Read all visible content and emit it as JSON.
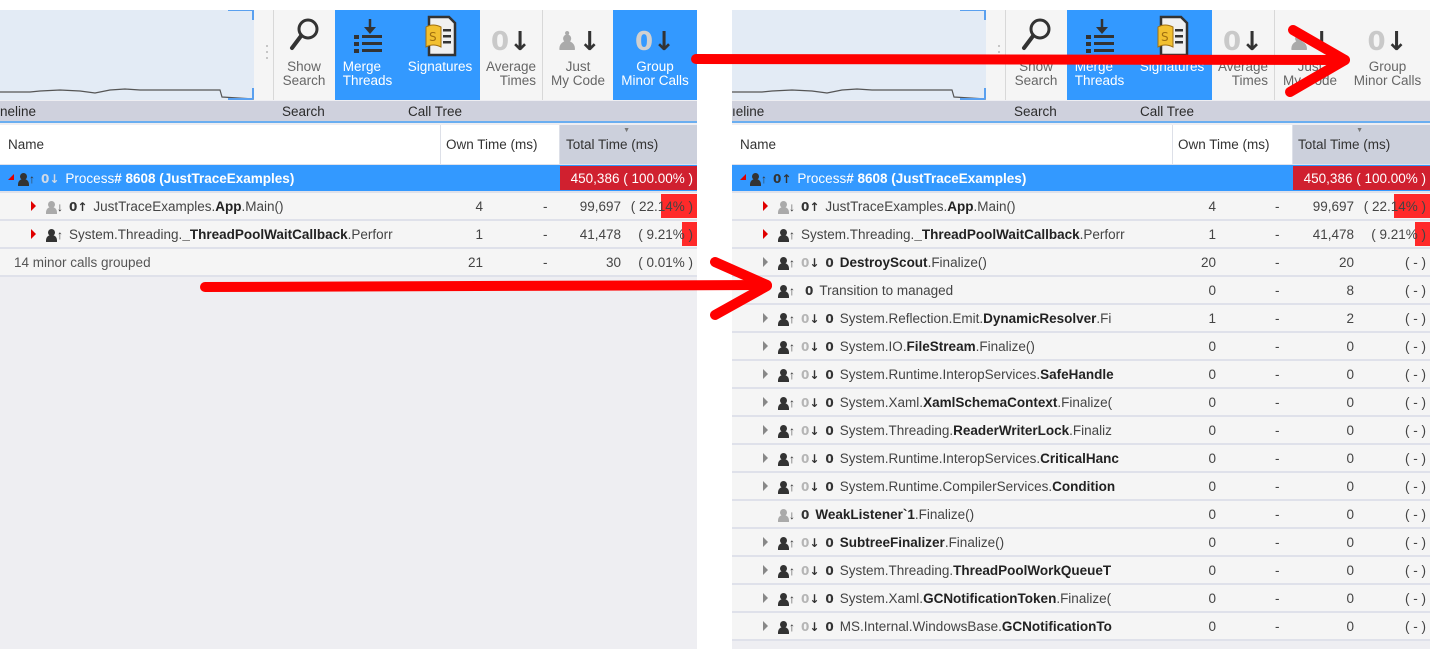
{
  "toolbar": {
    "buttons": [
      {
        "id": "show-search",
        "line1": "Show",
        "line2": "Search",
        "icon": "magnifier-icon"
      },
      {
        "id": "merge-threads",
        "line1": "Merge",
        "line2": "Threads",
        "icon": "merge-threads-icon"
      },
      {
        "id": "signatures",
        "line1": "Signatures",
        "line2": "",
        "icon": "signatures-icon"
      },
      {
        "id": "average-times",
        "line1": "Average",
        "line2": "Times",
        "icon": "zero-down-icon"
      },
      {
        "id": "just-my-code",
        "line1": "Just",
        "line2": "My Code",
        "icon": "person-down-icon"
      },
      {
        "id": "group-minor-calls",
        "line1": "Group",
        "line2": "Minor Calls",
        "icon": "zero-down-icon"
      }
    ],
    "sections": {
      "timeline": "neline",
      "timeline_right": "ıeline",
      "search": "Search",
      "call_tree": "Call Tree"
    }
  },
  "table": {
    "headers": {
      "name": "Name",
      "own": "Own Time (ms)",
      "total": "Total Time (ms)"
    }
  },
  "left": {
    "group_minor_calls_active": true,
    "rows": [
      {
        "kind": "process",
        "prefix": "Process ",
        "bold": "# 8608 (JustTraceExamples)",
        "suffix": "",
        "own": "",
        "dash": "",
        "total": "450,386 ( 100.00% )",
        "pct": 100
      },
      {
        "kind": "main",
        "prefix": "JustTraceExamples.",
        "bold": "App",
        "suffix": ".Main()",
        "own": "4",
        "dash": "-",
        "total_num": "99,697",
        "total_pct": "( 22.14% )",
        "pct": 22.14
      },
      {
        "kind": "threadpool",
        "prefix": "System.Threading.",
        "bold": "_ThreadPoolWaitCallback",
        "suffix": ".Perforr",
        "own": "1",
        "dash": "-",
        "total_num": "41,478",
        "total_pct": "( 9.21% )",
        "pct": 9.21
      },
      {
        "kind": "grouped",
        "prefix": "14 minor calls grouped",
        "bold": "",
        "suffix": "",
        "own": "21",
        "dash": "-",
        "total_num": "30",
        "total_pct": "( 0.01% )",
        "pct": 0.01
      }
    ]
  },
  "right": {
    "group_minor_calls_active": false,
    "rows": [
      {
        "kind": "process",
        "prefix": "Process ",
        "bold": "# 8608 (JustTraceExamples)",
        "suffix": "",
        "own": "",
        "dash": "",
        "total": "450,386 ( 100.00% )",
        "pct": 100
      },
      {
        "kind": "main",
        "prefix": "JustTraceExamples.",
        "bold": "App",
        "suffix": ".Main()",
        "own": "4",
        "dash": "-",
        "total_num": "99,697",
        "total_pct": "( 22.14% )",
        "pct": 22.14
      },
      {
        "kind": "threadpool",
        "prefix": "System.Threading.",
        "bold": "_ThreadPoolWaitCallback",
        "suffix": ".Perforr",
        "own": "1",
        "dash": "-",
        "total_num": "41,478",
        "total_pct": "( 9.21% )",
        "pct": 9.21
      },
      {
        "kind": "minor",
        "count": "0",
        "prefix": "",
        "bold": "DestroyScout",
        "suffix": ".Finalize()",
        "own": "20",
        "dash": "-",
        "total_num": "20",
        "total_pct": "( - )"
      },
      {
        "kind": "transition",
        "count": "0",
        "prefix": "Transition to managed",
        "bold": "",
        "suffix": "",
        "own": "0",
        "dash": "-",
        "total_num": "8",
        "total_pct": "( - )"
      },
      {
        "kind": "minor",
        "count": "0",
        "prefix": "System.Reflection.Emit.",
        "bold": "DynamicResolver",
        "suffix": ".Fi",
        "own": "1",
        "dash": "-",
        "total_num": "2",
        "total_pct": "( - )"
      },
      {
        "kind": "minor",
        "count": "0",
        "prefix": "System.IO.",
        "bold": "FileStream",
        "suffix": ".Finalize()",
        "own": "0",
        "dash": "-",
        "total_num": "0",
        "total_pct": "( - )"
      },
      {
        "kind": "minor",
        "count": "0",
        "prefix": "System.Runtime.InteropServices.",
        "bold": "SafeHandle",
        "suffix": "",
        "own": "0",
        "dash": "-",
        "total_num": "0",
        "total_pct": "( - )"
      },
      {
        "kind": "minor",
        "count": "0",
        "prefix": "System.Xaml.",
        "bold": "XamlSchemaContext",
        "suffix": ".Finalize(",
        "own": "0",
        "dash": "-",
        "total_num": "0",
        "total_pct": "( - )"
      },
      {
        "kind": "minor",
        "count": "0",
        "prefix": "System.Threading.",
        "bold": "ReaderWriterLock",
        "suffix": ".Finaliz",
        "own": "0",
        "dash": "-",
        "total_num": "0",
        "total_pct": "( - )"
      },
      {
        "kind": "minor",
        "count": "0",
        "prefix": "System.Runtime.InteropServices.",
        "bold": "CriticalHanc",
        "suffix": "",
        "own": "0",
        "dash": "-",
        "total_num": "0",
        "total_pct": "( - )"
      },
      {
        "kind": "minor",
        "count": "0",
        "prefix": "System.Runtime.CompilerServices.",
        "bold": "Condition",
        "suffix": "",
        "own": "0",
        "dash": "-",
        "total_num": "0",
        "total_pct": "( - )"
      },
      {
        "kind": "weak",
        "count": "0",
        "prefix": "",
        "bold": "WeakListener`1",
        "suffix": ".Finalize()",
        "own": "0",
        "dash": "-",
        "total_num": "0",
        "total_pct": "( - )"
      },
      {
        "kind": "minor",
        "count": "0",
        "prefix": "",
        "bold": "SubtreeFinalizer",
        "suffix": ".Finalize()",
        "own": "0",
        "dash": "-",
        "total_num": "0",
        "total_pct": "( - )"
      },
      {
        "kind": "minor",
        "count": "0",
        "prefix": "System.Threading.",
        "bold": "ThreadPoolWorkQueueT",
        "suffix": "",
        "own": "0",
        "dash": "-",
        "total_num": "0",
        "total_pct": "( - )"
      },
      {
        "kind": "minor",
        "count": "0",
        "prefix": "System.Xaml.",
        "bold": "GCNotificationToken",
        "suffix": ".Finalize(",
        "own": "0",
        "dash": "-",
        "total_num": "0",
        "total_pct": "( - )"
      },
      {
        "kind": "minor",
        "count": "0",
        "prefix": "MS.Internal.WindowsBase.",
        "bold": "GCNotificationTo",
        "suffix": "",
        "own": "0",
        "dash": "-",
        "total_num": "0",
        "total_pct": "( - )"
      }
    ]
  },
  "colors": {
    "accent": "#3399ff",
    "total_highlight": "#d0202f",
    "pct_bar": "#ff2a2a",
    "annotation_arrow": "#ff0000"
  }
}
